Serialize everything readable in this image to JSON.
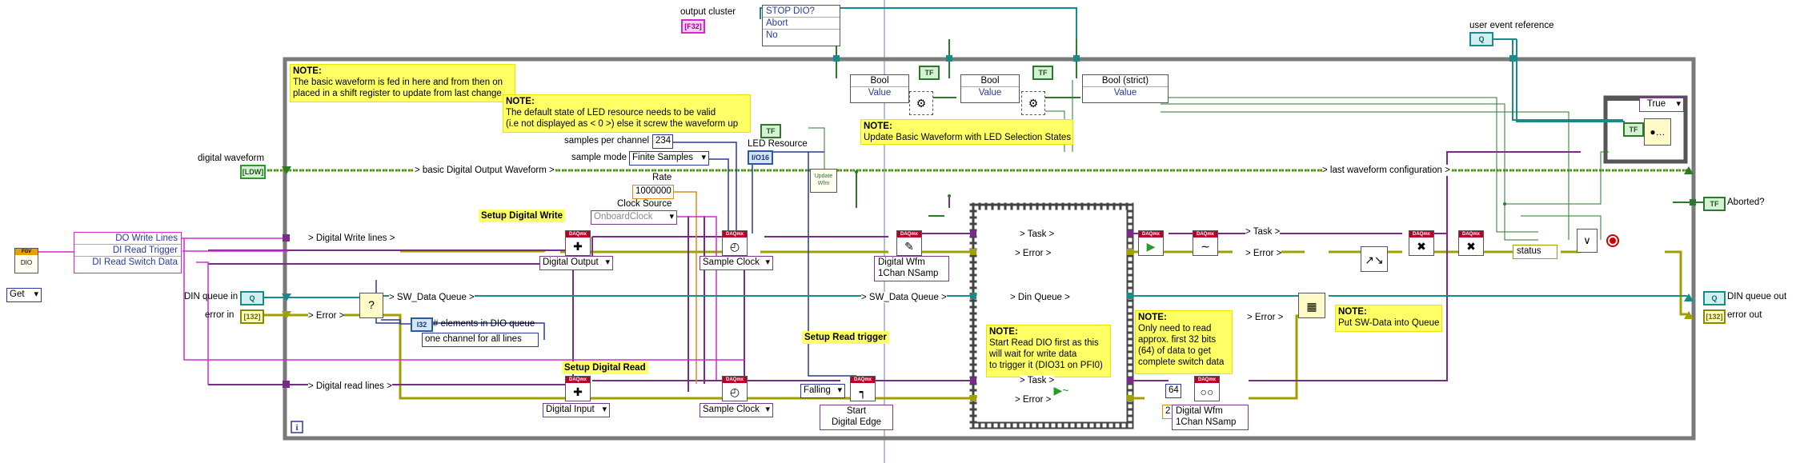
{
  "controls": {
    "output_cluster": "output cluster",
    "user_event_reference": "user event reference",
    "digital_waveform": "digital  waveform",
    "din_queue_in": "DIN queue in",
    "error_in": "error in",
    "aborted": "Aborted?",
    "din_queue_out": "DIN queue out",
    "error_out": "error out"
  },
  "terminal_tags": {
    "output_cluster": "[F32]",
    "digital_waveform": "[LDW]",
    "aborted": "TF",
    "din_queue_in": "Q",
    "din_queue_out": "Q",
    "error_in": "[132]",
    "error_out": "[132]",
    "user_event": "Q",
    "led_resource": "I/O16",
    "tf_const": "TF",
    "i32": "I32",
    "fgv": "FGV",
    "dio": "DIO"
  },
  "unbundle_stop": [
    "STOP DIO?",
    "Abort",
    "No"
  ],
  "bool_nodes": [
    "Bool",
    "Bool",
    "Bool (strict)"
  ],
  "value_label": "Value",
  "case_selector": "True",
  "fgv_unbundle": [
    "DO Write Lines",
    "DI Read Trigger",
    "DI Read Switch Data"
  ],
  "get_label": "Get",
  "wires": {
    "basic_waveform": "> basic Digital Output Waveform >",
    "last_waveform": "> last waveform configuration >",
    "digital_write_lines": "> Digital Write lines >",
    "sw_data_queue": "> SW_Data Queue >",
    "sw_data_queue2": "> SW_Data Queue >",
    "error": "> Error >",
    "error2": "> Error >",
    "error3": "> Error >",
    "error4": "> Error >",
    "digital_read_lines": "> Digital read lines >",
    "task": "> Task >",
    "task2": "> Task >",
    "task3": "> Task >",
    "din_queue": "> Din Queue >",
    "status": "status"
  },
  "notes": {
    "note1": [
      "NOTE:",
      "The basic waveform is fed in here and from then on",
      "placed in a shift register to update from last change"
    ],
    "note2": [
      "NOTE:",
      "The default state of LED resource needs to be valid",
      "(i.e not displayed as < 0 >) else it screw the waveform up"
    ],
    "note3": [
      "NOTE:",
      "Update Basic Waveform with LED Selection States"
    ],
    "note4": [
      "NOTE:",
      "Start Read DIO first as this",
      "will wait for write data",
      "to trigger it (DIO31 on PFI0)"
    ],
    "note5": [
      "NOTE:",
      "Only need to read",
      "approx. first 32 bits",
      "(64) of data to get",
      "complete switch data"
    ],
    "note6": [
      "NOTE:",
      "Put SW-Data into Queue"
    ]
  },
  "labels": {
    "samples_per_channel": "samples per channel",
    "sample_mode": "sample mode",
    "rate": "Rate",
    "clock_source": "Clock Source",
    "led_resource": "LED Resource",
    "elements_in_queue": "# elements in DIO queue",
    "setup_digital_write": "Setup Digital Write",
    "setup_digital_read": "Setup Digital Read",
    "setup_read_trigger": "Setup Read trigger",
    "update_wfm": "Update Wfm"
  },
  "constants": {
    "samples_per_channel": "234",
    "sample_mode": "Finite Samples",
    "rate": "1000000",
    "clock_source": "OnboardClock",
    "one_channel": "one channel for all lines",
    "sixty_four": "64",
    "two": "2"
  },
  "rings": {
    "digital_output": "Digital Output",
    "digital_input": "Digital Input",
    "sample_clock": "Sample Clock",
    "sample_clock2": "Sample Clock",
    "falling": "Falling",
    "write_wfm": [
      "Digital Wfm",
      "1Chan NSamp"
    ],
    "read_wfm": [
      "Digital Wfm",
      "1Chan NSamp"
    ],
    "start_digital_edge": [
      "Start",
      "Digital Edge"
    ]
  },
  "icon_names": [
    "daqmx-create-channel-icon",
    "daqmx-timing-icon",
    "daqmx-write-icon",
    "daqmx-start-icon",
    "daqmx-read-icon",
    "daqmx-trigger-icon",
    "daqmx-clear-icon",
    "queue-enqueue-icon",
    "error-cluster-icon",
    "or-icon",
    "stop-icon"
  ],
  "colors": {
    "boolean": "#2a7a2a",
    "waveform": "#d8a000",
    "error": "#9c9c00",
    "task": "#7a2a8c",
    "queue": "#1a8a8a",
    "numeric": "#2a3a9c",
    "string": "#d02ad0",
    "loop": "#7a7a7a",
    "note": "#ffff66"
  }
}
